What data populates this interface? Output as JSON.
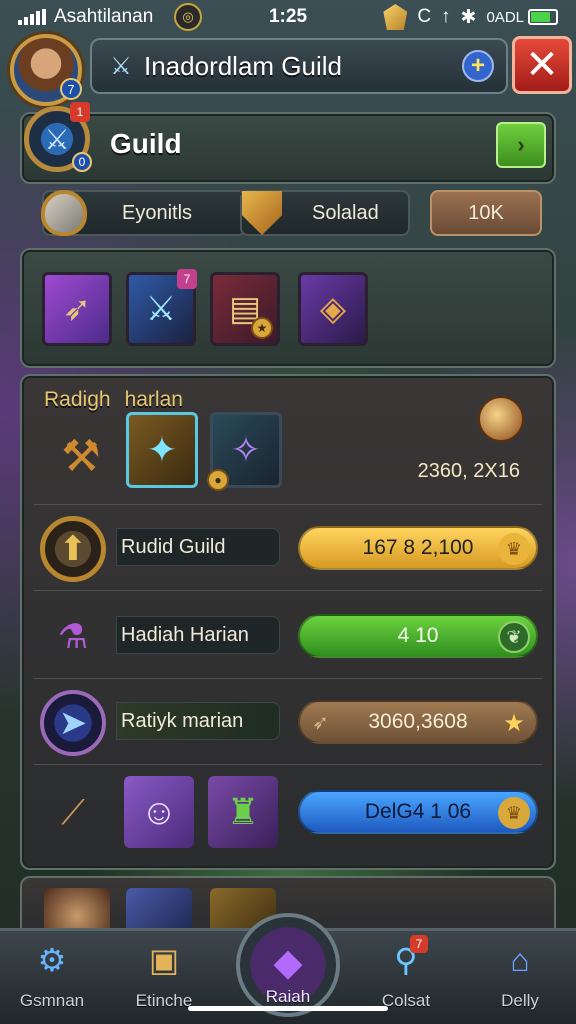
{
  "status_bar": {
    "carrier": "Asahtilanan",
    "time": "1:25",
    "battery_label": "0ADL"
  },
  "header": {
    "title": "Inadordlam Guild",
    "avatar_level": "7",
    "plus_icon": "plus-icon",
    "close_icon": "close-icon"
  },
  "guild": {
    "label": "Guild",
    "emblem_badge": "1",
    "emblem_level": "0"
  },
  "stats": [
    {
      "label": "Eyonitls",
      "icon": "shield-icon"
    },
    {
      "label": "Solalad",
      "icon": "crest-icon"
    },
    {
      "label": "10K"
    }
  ],
  "items": [
    {
      "name": "crossbow",
      "badge": ""
    },
    {
      "name": "blue-sword",
      "badge": ""
    },
    {
      "name": "spellbook",
      "badge": ""
    },
    {
      "name": "treasure-chest",
      "badge": ""
    }
  ],
  "item_badges": {
    "blue_sword": "7"
  },
  "rewards": {
    "heading_left": "Radigh",
    "heading_right": "harlan",
    "value": "2360, 2X16",
    "rows": [
      {
        "label": "Rudid Guild",
        "value": "167 8 2,100",
        "style": "gold"
      },
      {
        "label": "Hadiah Harian",
        "value": "4 10",
        "style": "green"
      },
      {
        "label": "Ratiyk marian",
        "value": "3060,3608",
        "style": "tan"
      },
      {
        "label": "",
        "value": "DelG4 1 06",
        "style": "blue"
      }
    ]
  },
  "tabs": [
    {
      "label": "Gsmnan",
      "icon": "gear-shield-icon"
    },
    {
      "label": "Etinche",
      "icon": "chest-icon"
    },
    {
      "label": "Raiah",
      "icon": "crystal-icon"
    },
    {
      "label": "Colsat",
      "icon": "search-icon",
      "badge": "7"
    },
    {
      "label": "Delly",
      "icon": "shop-icon"
    }
  ]
}
